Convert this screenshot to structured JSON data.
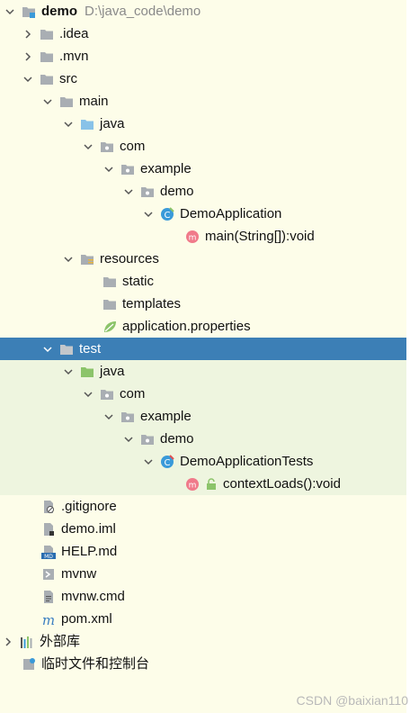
{
  "tree": {
    "root": {
      "name": "demo",
      "path": "D:\\java_code\\demo"
    },
    "items": [
      {
        "label": ".idea"
      },
      {
        "label": ".mvn"
      },
      {
        "label": "src"
      },
      {
        "label": "main"
      },
      {
        "label": "java"
      },
      {
        "label": "com"
      },
      {
        "label": "example"
      },
      {
        "label": "demo"
      },
      {
        "label": "DemoApplication"
      },
      {
        "label": "main(String[]):void"
      },
      {
        "label": "resources"
      },
      {
        "label": "static"
      },
      {
        "label": "templates"
      },
      {
        "label": "application.properties"
      },
      {
        "label": "test"
      },
      {
        "label": "java"
      },
      {
        "label": "com"
      },
      {
        "label": "example"
      },
      {
        "label": "demo"
      },
      {
        "label": "DemoApplicationTests"
      },
      {
        "label": "contextLoads():void"
      },
      {
        "label": ".gitignore"
      },
      {
        "label": "demo.iml"
      },
      {
        "label": "HELP.md"
      },
      {
        "label": "mvnw"
      },
      {
        "label": "mvnw.cmd"
      },
      {
        "label": "pom.xml"
      },
      {
        "label": "外部库"
      },
      {
        "label": "临时文件和控制台"
      }
    ],
    "selected": "test"
  },
  "watermark": "CSDN @baixian110",
  "colors": {
    "background": "#fdfde9",
    "selection": "#3c7fb6",
    "test_highlight": "#eef5df",
    "folder": "#a9aeb3",
    "source_folder": "#88c2e8",
    "test_folder": "#8cc46a",
    "class_icon": "#3a9ad9",
    "method_icon": "#f07a8a"
  }
}
